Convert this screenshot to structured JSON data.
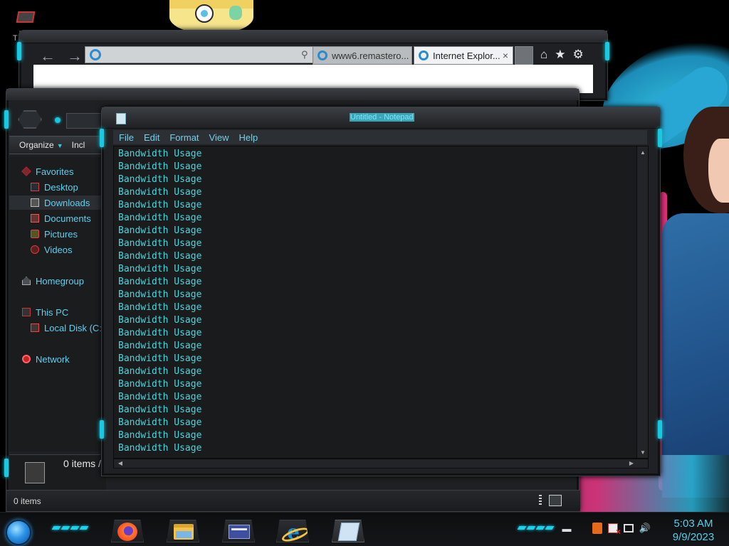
{
  "desktop": {
    "top_icon_letter": "T"
  },
  "ie": {
    "url": "",
    "tabs": [
      {
        "label": "www6.remastero..."
      },
      {
        "label": "Internet Explor...",
        "close": "×"
      }
    ],
    "nav": {
      "back": "←",
      "forward": "→"
    },
    "addr_tools": {
      "search": "⚲",
      "drop": "▾",
      "refresh": "↻"
    },
    "right_icons": {
      "home": "⌂",
      "favorites": "★",
      "settings": "⚙"
    }
  },
  "explorer": {
    "toolbar": {
      "organize": "Organize",
      "include": "Incl"
    },
    "nav": [
      {
        "label": "Favorites",
        "icon": "star-icon",
        "indent": 0,
        "selected": false
      },
      {
        "label": "Desktop",
        "icon": "desktop-icon",
        "indent": 1,
        "selected": false
      },
      {
        "label": "Downloads",
        "icon": "downloads-icon",
        "indent": 1,
        "selected": true
      },
      {
        "label": "Documents",
        "icon": "documents-icon",
        "indent": 1,
        "selected": false
      },
      {
        "label": "Pictures",
        "icon": "pictures-icon",
        "indent": 1,
        "selected": false
      },
      {
        "label": "Videos",
        "icon": "videos-icon",
        "indent": 1,
        "selected": false
      },
      {
        "label": "Homegroup",
        "icon": "homegroup-icon",
        "indent": 0,
        "selected": false
      },
      {
        "label": "This PC",
        "icon": "computer-icon",
        "indent": 0,
        "selected": false
      },
      {
        "label": "Local Disk (C:",
        "icon": "disk-icon",
        "indent": 1,
        "selected": false
      },
      {
        "label": "Network",
        "icon": "network-icon",
        "indent": 0,
        "selected": false
      }
    ],
    "info_count": "0 items /",
    "status_text": "0 items"
  },
  "notepad": {
    "title": "Untitled - Notepad",
    "menu": [
      "File",
      "Edit",
      "Format",
      "View",
      "Help"
    ],
    "lines": [
      "Bandwidth Usage",
      "Bandwidth Usage",
      "Bandwidth Usage",
      "Bandwidth Usage",
      "Bandwidth Usage",
      "Bandwidth Usage",
      "Bandwidth Usage",
      "Bandwidth Usage",
      "Bandwidth Usage",
      "Bandwidth Usage",
      "Bandwidth Usage",
      "Bandwidth Usage",
      "Bandwidth Usage",
      "Bandwidth Usage",
      "Bandwidth Usage",
      "Bandwidth Usage",
      "Bandwidth Usage",
      "Bandwidth Usage",
      "Bandwidth Usage",
      "Bandwidth Usage",
      "Bandwidth Usage",
      "Bandwidth Usage",
      "Bandwidth Usage",
      "Bandwidth Usage"
    ]
  },
  "taskbar": {
    "apps": [
      {
        "name": "firefox",
        "icon": "firefox-icon"
      },
      {
        "name": "file-explorer",
        "icon": "folder-icon"
      },
      {
        "name": "control-panel",
        "icon": "control-panel-icon"
      },
      {
        "name": "internet-explorer",
        "icon": "ie-icon",
        "glyph": "e"
      },
      {
        "name": "notepad",
        "icon": "notepad-icon"
      }
    ],
    "tray": {
      "volume": "🔊"
    },
    "time": "5:03 AM",
    "date": "9/9/2023"
  }
}
